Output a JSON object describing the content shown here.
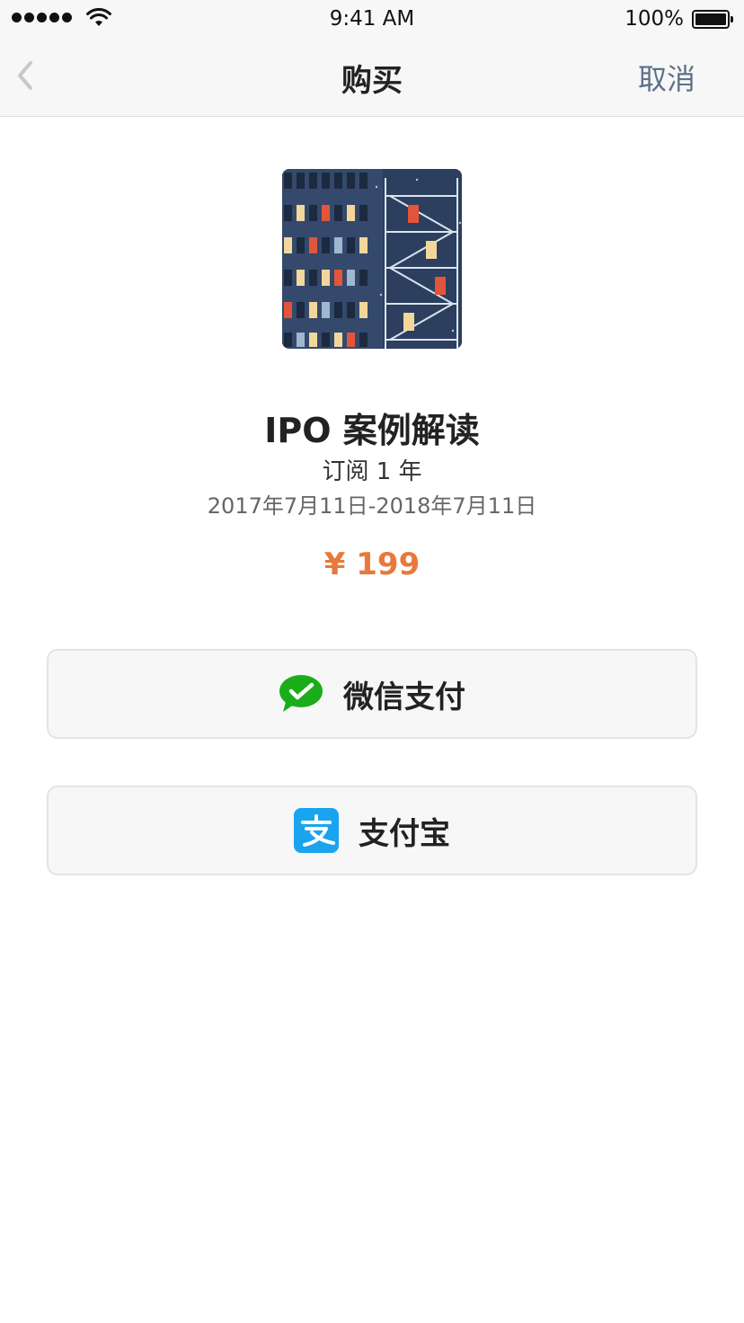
{
  "status_bar": {
    "time": "9:41 AM",
    "battery_percent": "100%",
    "signal_bars": 5
  },
  "nav": {
    "title": "购买",
    "cancel_label": "取消",
    "back_icon": "chevron-left-icon"
  },
  "product": {
    "cover_icon": "building-illustration",
    "title": "IPO 案例解读",
    "subscription": "订阅 1 年",
    "date_range": "2017年7月11日-2018年7月11日",
    "price": "¥ 199"
  },
  "payment": {
    "wechat_label": "微信支付",
    "alipay_label": "支付宝",
    "wechat_icon": "wechat-pay-icon",
    "alipay_icon": "alipay-icon"
  },
  "colors": {
    "price": "#e8793a",
    "cancel": "#5d7189",
    "wechat_green": "#1aad19",
    "alipay_blue": "#1aa3ee"
  }
}
